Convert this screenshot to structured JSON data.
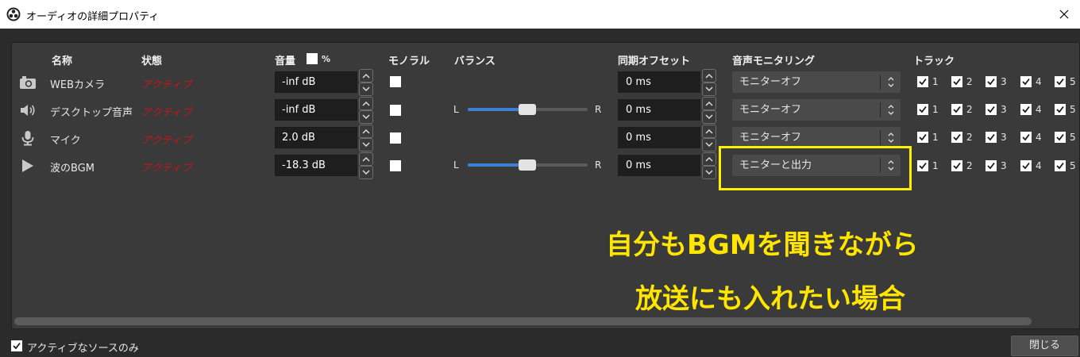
{
  "window": {
    "title": "オーディオの詳細プロパティ"
  },
  "headers": {
    "name": "名称",
    "status": "状態",
    "volume": "音量",
    "volume_unit": "%",
    "mono": "モノラル",
    "balance": "バランス",
    "sync_offset": "同期オフセット",
    "monitoring": "音声モニタリング",
    "tracks": "トラック"
  },
  "sources": [
    {
      "icon": "camera-icon",
      "name": "WEBカメラ",
      "status": "アクティブ",
      "volume": "-inf dB",
      "mono": false,
      "balance": null,
      "sync": "0 ms",
      "monitoring": "モニターオフ",
      "tracks": [
        "1",
        "2",
        "3",
        "4",
        "5"
      ]
    },
    {
      "icon": "speaker-icon",
      "name": "デスクトップ音声",
      "status": "アクティブ",
      "volume": "-inf dB",
      "mono": false,
      "balance": 0.5,
      "sync": "0 ms",
      "monitoring": "モニターオフ",
      "tracks": [
        "1",
        "2",
        "3",
        "4",
        "5"
      ]
    },
    {
      "icon": "microphone-icon",
      "name": "マイク",
      "status": "アクティブ",
      "volume": "2.0 dB",
      "mono": false,
      "balance": null,
      "sync": "0 ms",
      "monitoring": "モニターオフ",
      "tracks": [
        "1",
        "2",
        "3",
        "4",
        "5"
      ]
    },
    {
      "icon": "play-icon",
      "name": "波のBGM",
      "status": "アクティブ",
      "volume": "-18.3 dB",
      "mono": false,
      "balance": 0.5,
      "sync": "0 ms",
      "monitoring": "モニターと出力",
      "tracks": [
        "1",
        "2",
        "3",
        "4",
        "5"
      ]
    }
  ],
  "balance_labels": {
    "left": "L",
    "right": "R"
  },
  "annotation": {
    "line1": "自分もBGMを聞きながら",
    "line2": "放送にも入れたい場合",
    "color": "#ffe500"
  },
  "footer": {
    "active_only_label": "アクティブなソースのみ",
    "active_only_checked": true,
    "close_label": "閉じる"
  },
  "colors": {
    "status_active": "#c8161a",
    "slider_fill": "#3c80d6",
    "highlight_border": "#ffef00"
  }
}
